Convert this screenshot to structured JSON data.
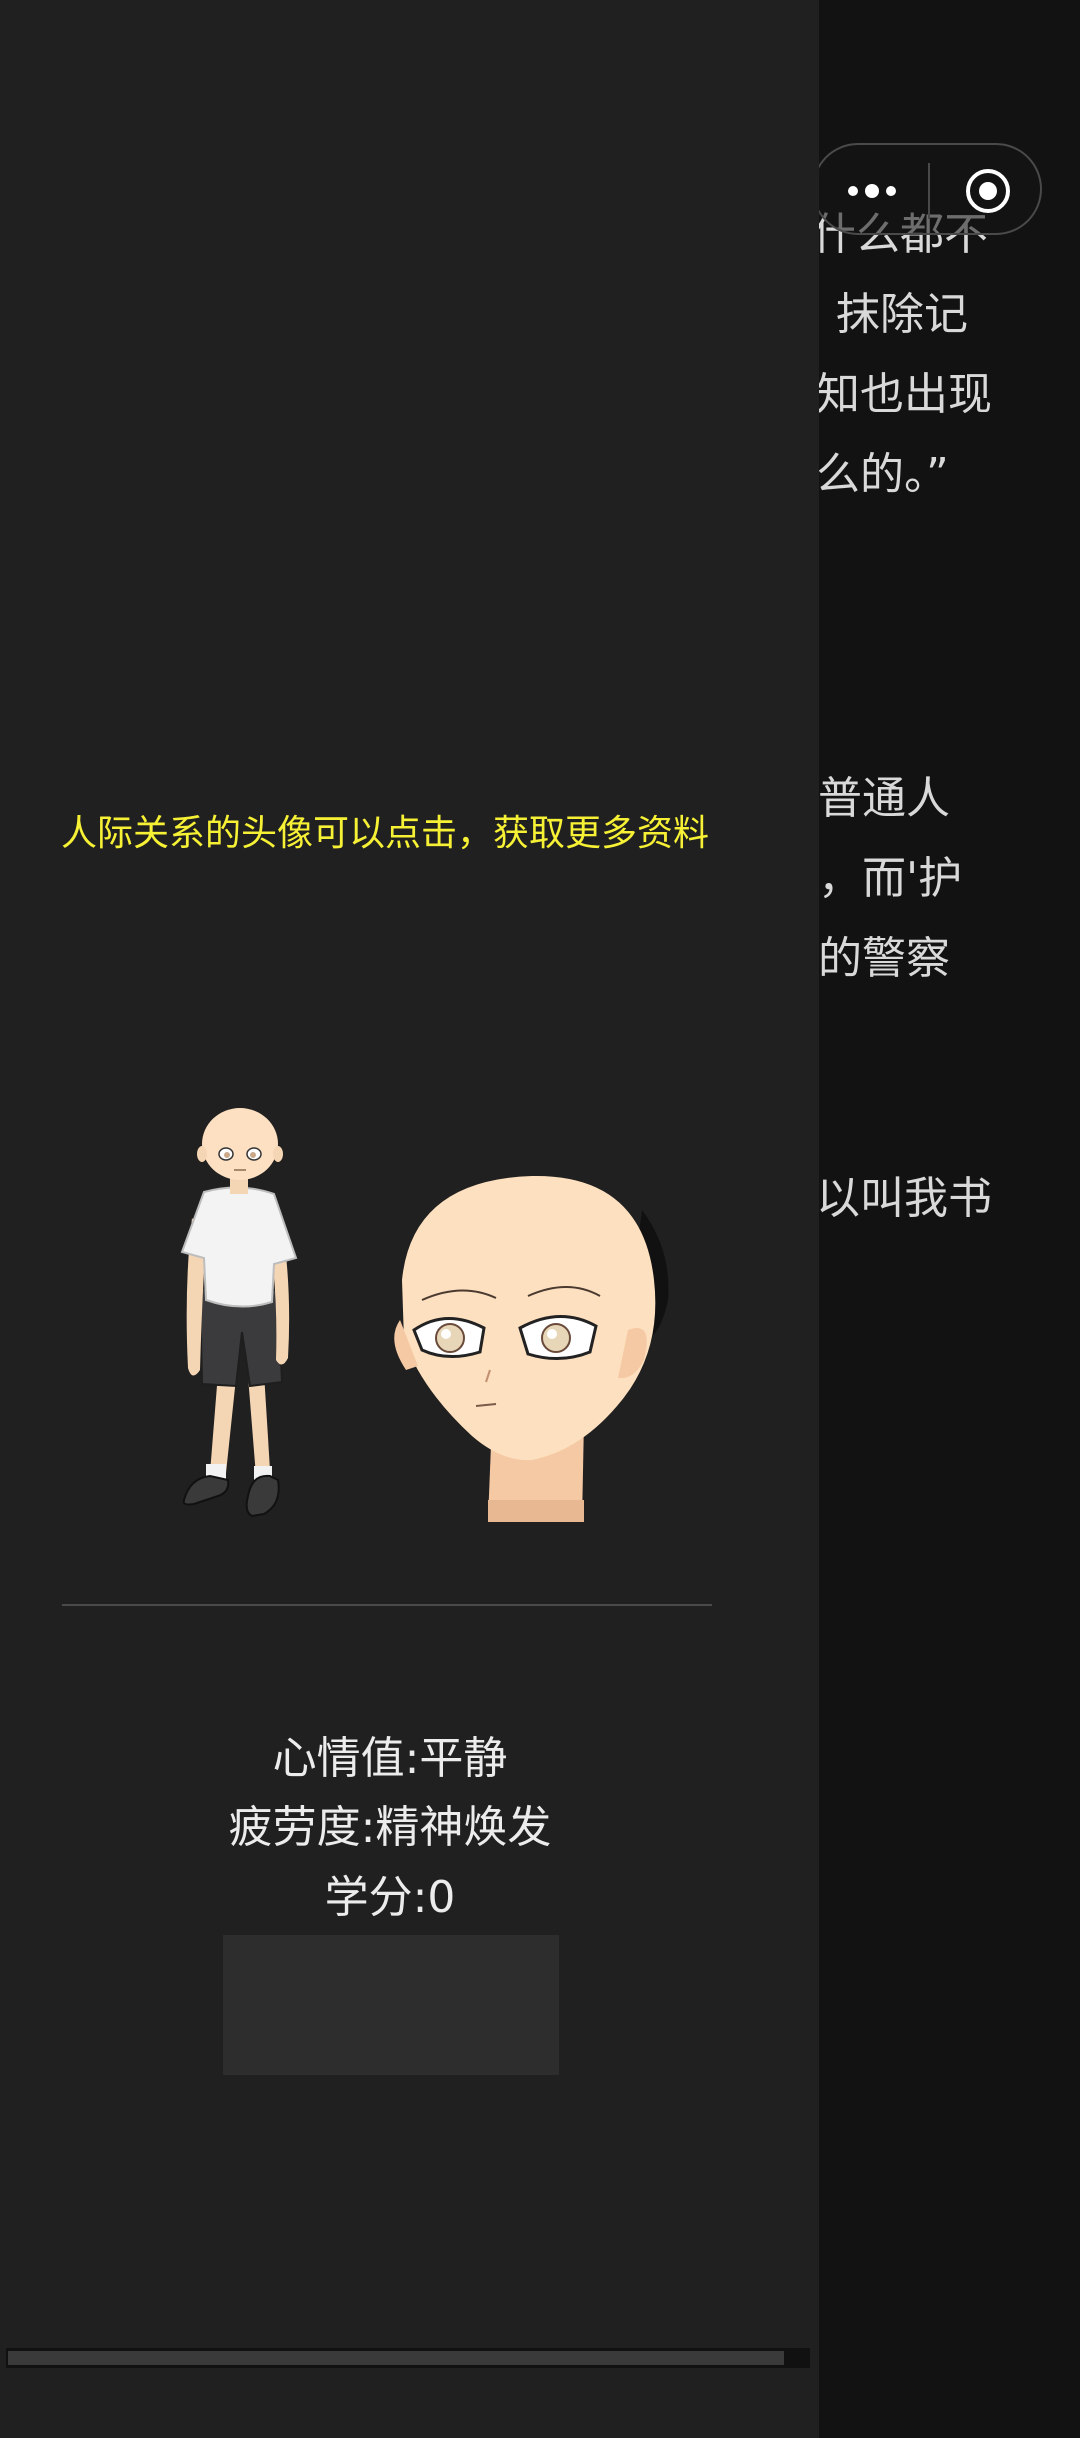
{
  "background_story": {
    "lines": [
      "什么都不",
      "抹除记",
      "知也出现",
      "么的。”",
      "普通人",
      "，而'护",
      "的警察",
      "以叫我书"
    ]
  },
  "capsule": {
    "more_icon": "more-dots-icon",
    "close_icon": "target-close-icon"
  },
  "drawer": {
    "tip": "人际关系的头像可以点击，获取更多资料",
    "stats": {
      "mood": "心情值:平静",
      "fatigue": "疲劳度:精神焕发",
      "credits": "学分:0"
    }
  },
  "colors": {
    "drawer_bg": "#202020",
    "page_bg": "#121212",
    "tip_color": "#f7f135",
    "stat_text": "#ececec"
  }
}
